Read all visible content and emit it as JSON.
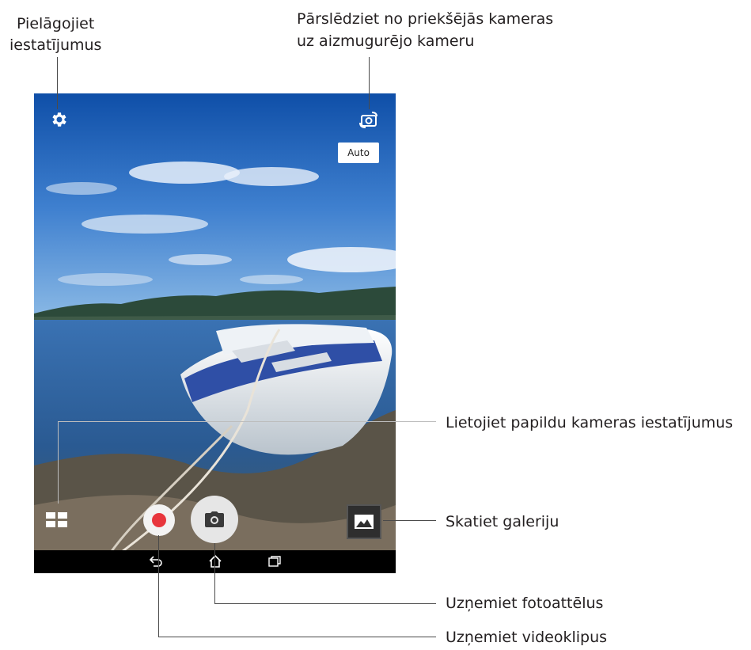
{
  "callouts": {
    "settings_line1": "Pielāgojiet",
    "settings_line2": "iestatījumus",
    "switch_line1": "Pārslēdziet no priekšējās kameras",
    "switch_line2": "uz aizmugurējo kameru",
    "advanced": "Lietojiet papildu kameras iestatījumus",
    "gallery": "Skatiet galeriju",
    "photo": "Uzņemiet fotoattēlus",
    "video": "Uzņemiet videoklipus"
  },
  "camera_ui": {
    "mode_chip": "Auto",
    "icons": {
      "settings": "gear-icon",
      "switch_camera": "camera-switch-icon",
      "advanced": "grid-icon",
      "record": "record-icon",
      "shutter": "camera-icon",
      "gallery": "image-icon",
      "back": "back-icon",
      "home": "home-icon",
      "recents": "recents-icon"
    },
    "colors": {
      "record": "#e8363d",
      "shutter_bg": "#e6e6e6",
      "navbar": "#000000"
    }
  }
}
